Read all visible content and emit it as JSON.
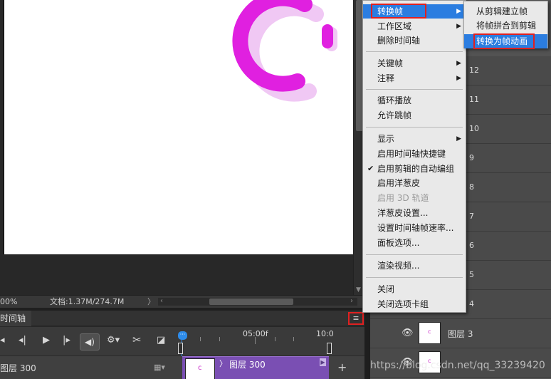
{
  "status_bar": {
    "zoom": "00%",
    "doc": "文档:1.37M/274.7M",
    "arrow": "〉"
  },
  "timeline": {
    "tab": "时间轴",
    "menu_icon": "≡",
    "ruler_05": "05:00f",
    "ruler_10": "10:0",
    "layer_name": "图层 300",
    "clip_label": "图层 300",
    "controls": [
      "⏮",
      "◀|",
      "▶",
      "|▶",
      "🔊",
      "⚙",
      "✂",
      "◪"
    ]
  },
  "layers_panel": {
    "rows": [
      {
        "num": "12"
      },
      {
        "num": "11"
      },
      {
        "num": "10"
      },
      {
        "num": "9"
      },
      {
        "num": "8"
      },
      {
        "num": "7"
      },
      {
        "num": "6"
      },
      {
        "num": "5"
      },
      {
        "num": "4"
      }
    ],
    "layer3": {
      "name": "图层 3"
    }
  },
  "context_menu": {
    "convert_frame": "转换帧",
    "work_area": "工作区域",
    "delete_timeline": "删除时间轴",
    "keyframes": "关键帧",
    "comments": "注释",
    "loop_playback": "循环播放",
    "allow_frame_skip": "允许跳帧",
    "show": "显示",
    "enable_shortcuts": "启用时间轴快捷键",
    "auto_group": "启用剪辑的自动编组",
    "onion_skin": "启用洋葱皮",
    "enable_3d": "启用 3D 轨道",
    "onion_settings": "洋葱皮设置...",
    "set_frame_rate": "设置时间轴帧速率...",
    "panel_options": "面板选项...",
    "render_video": "渲染视频...",
    "close": "关闭",
    "close_tab_group": "关闭选项卡组"
  },
  "submenu": {
    "make_frames_from_clips": "从剪辑建立帧",
    "flatten_frames": "将帧拼合到剪辑",
    "convert_to_frame_animation": "转换为帧动画"
  },
  "watermark": "https://blog.csdn.net/qq_33239420",
  "colors": {
    "accent_pink": "#e020e0",
    "highlight_blue": "#2b7de0",
    "annotation_red": "#e02020"
  }
}
